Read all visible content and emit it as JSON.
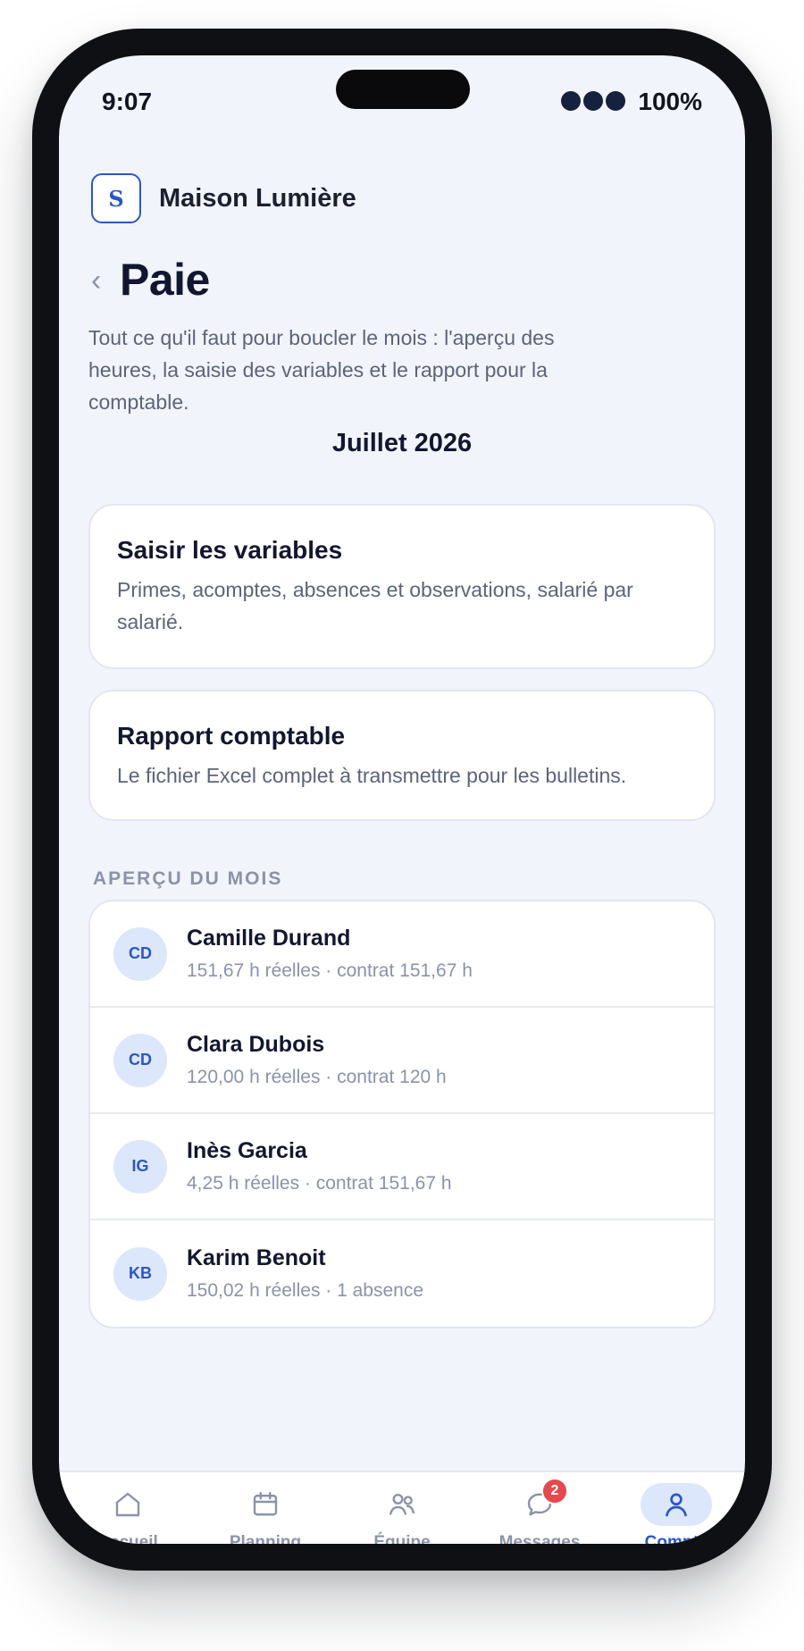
{
  "status_bar": {
    "time": "9:07",
    "battery": "100%"
  },
  "org": {
    "logo_letter": "S",
    "name": "Maison Lumière"
  },
  "header": {
    "back_icon": "chevron-left-icon",
    "title": "Paie",
    "intro": "Tout ce qu'il faut pour boucler le mois : l'aperçu des heures, la saisie des variables et le rapport pour la comptable."
  },
  "month": "Juillet 2026",
  "cards": [
    {
      "title": "Saisir les variables",
      "description": "Primes, acomptes, absences et observations, salarié par salarié."
    },
    {
      "title": "Rapport comptable",
      "description": "Le fichier Excel complet à transmettre pour les bulletins."
    }
  ],
  "overview": {
    "label": "APERÇU DU MOIS",
    "employees": [
      {
        "initials": "CD",
        "name": "Camille Durand",
        "meta": "151,67 h réelles · contrat 151,67 h"
      },
      {
        "initials": "CD",
        "name": "Clara Dubois",
        "meta": "120,00 h réelles · contrat 120 h"
      },
      {
        "initials": "IG",
        "name": "Inès Garcia",
        "meta": "4,25 h réelles · contrat 151,67 h"
      },
      {
        "initials": "KB",
        "name": "Karim Benoit",
        "meta": "150,02 h réelles · 1 absence"
      }
    ]
  },
  "tabbar": {
    "tabs": [
      {
        "label": "Accueil",
        "icon": "home-icon"
      },
      {
        "label": "Planning",
        "icon": "calendar-icon"
      },
      {
        "label": "Équipe",
        "icon": "team-icon"
      },
      {
        "label": "Messages",
        "icon": "chat-icon",
        "badge": "2"
      },
      {
        "label": "Compte",
        "icon": "user-icon",
        "active": true
      }
    ]
  },
  "colors": {
    "accent": "#2a56c6",
    "badge": "#e5484d",
    "background": "#f2f4fb"
  }
}
